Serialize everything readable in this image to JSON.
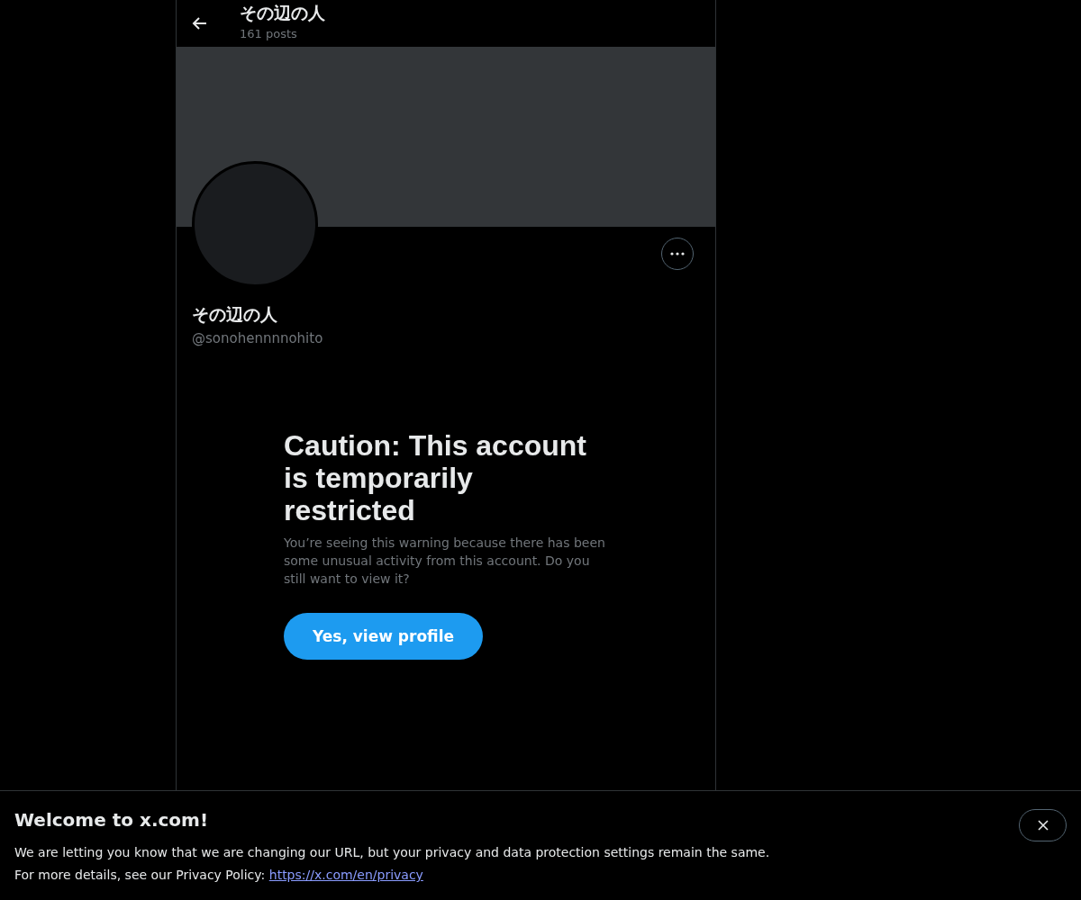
{
  "header": {
    "title": "その辺の人",
    "subtitle": "161 posts"
  },
  "profile": {
    "name": "その辺の人",
    "handle": "@sonohennnnohito"
  },
  "warning": {
    "title": "Caution: This account is temporarily restricted",
    "body": "You’re seeing this warning because there has been some unusual activity from this account. Do you still want to view it?",
    "button": "Yes, view profile"
  },
  "cookie_banner": {
    "title": "Welcome to x.com!",
    "message": "We are letting you know that we are changing our URL, but your privacy and data protection settings remain the same.",
    "details": "For more details, see our Privacy Policy: ",
    "link": "https://x.com/en/privacy"
  }
}
